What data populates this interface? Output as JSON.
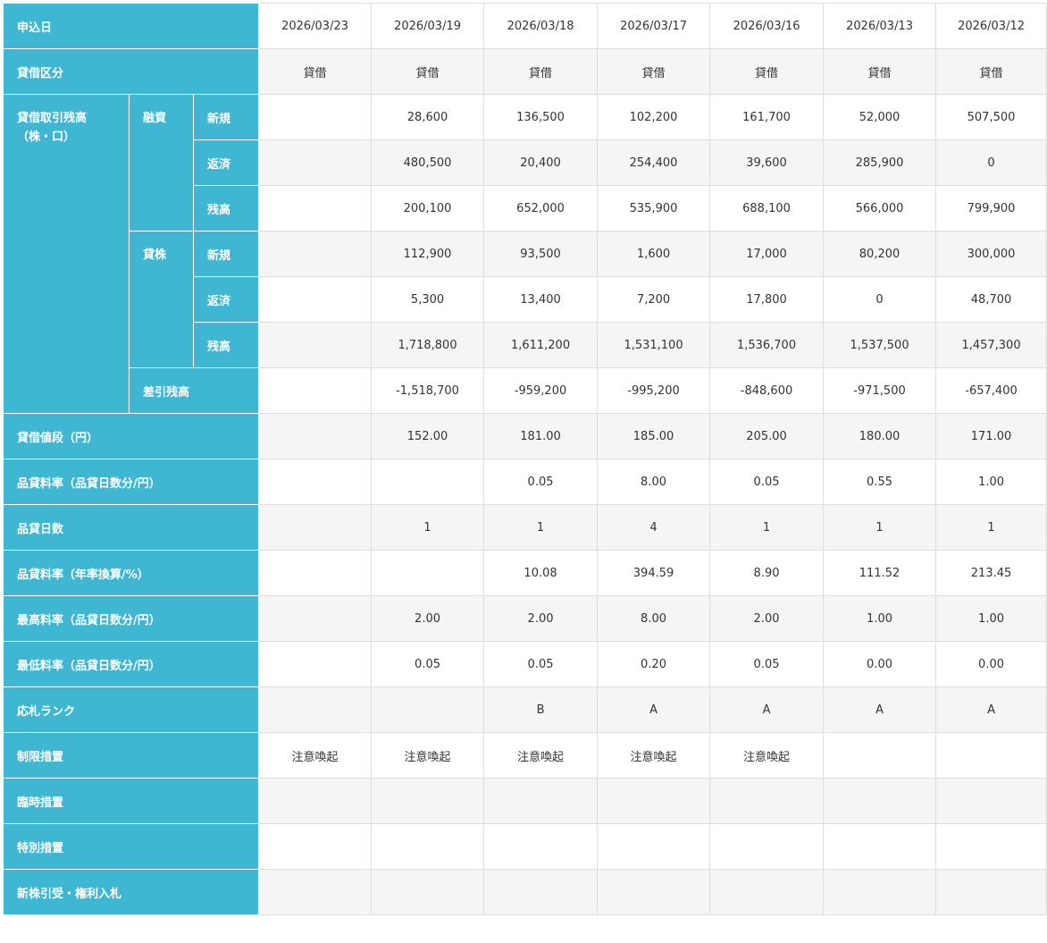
{
  "dates": [
    "2026/03/23",
    "2026/03/19",
    "2026/03/18",
    "2026/03/17",
    "2026/03/16",
    "2026/03/13",
    "2026/03/12"
  ],
  "labels": {
    "date": "申込日",
    "type": "貸借区分",
    "balance_line1": "貸借取引残高",
    "balance_line2": "（株・口）",
    "loan_funds": "融資",
    "loan_stock": "貸株",
    "new": "新規",
    "repay": "返済",
    "balance": "残高",
    "net": "差引残高",
    "price": "貸借値段（円）",
    "fee_rate": "品貸料率（品貸日数分/円）",
    "fee_days": "品貸日数",
    "fee_annual": "品貸料率（年率換算/%）",
    "max_rate": "最高料率（品貸日数分/円）",
    "min_rate": "最低料率（品貸日数分/円）",
    "bid_rank": "応札ランク",
    "restriction": "制限措置",
    "temporary": "臨時措置",
    "special": "特別措置",
    "new_shares": "新株引受・権利入札"
  },
  "rows": {
    "type": [
      "貸借",
      "貸借",
      "貸借",
      "貸借",
      "貸借",
      "貸借",
      "貸借"
    ],
    "funds_new": [
      "",
      "28,600",
      "136,500",
      "102,200",
      "161,700",
      "52,000",
      "507,500"
    ],
    "funds_repay": [
      "",
      "480,500",
      "20,400",
      "254,400",
      "39,600",
      "285,900",
      "0"
    ],
    "funds_balance": [
      "",
      "200,100",
      "652,000",
      "535,900",
      "688,100",
      "566,000",
      "799,900"
    ],
    "stock_new": [
      "",
      "112,900",
      "93,500",
      "1,600",
      "17,000",
      "80,200",
      "300,000"
    ],
    "stock_repay": [
      "",
      "5,300",
      "13,400",
      "7,200",
      "17,800",
      "0",
      "48,700"
    ],
    "stock_balance": [
      "",
      "1,718,800",
      "1,611,200",
      "1,531,100",
      "1,536,700",
      "1,537,500",
      "1,457,300"
    ],
    "net": [
      "",
      "-1,518,700",
      "-959,200",
      "-995,200",
      "-848,600",
      "-971,500",
      "-657,400"
    ],
    "price": [
      "",
      "152.00",
      "181.00",
      "185.00",
      "205.00",
      "180.00",
      "171.00"
    ],
    "fee_rate": [
      "",
      "",
      "0.05",
      "8.00",
      "0.05",
      "0.55",
      "1.00"
    ],
    "fee_days": [
      "",
      "1",
      "1",
      "4",
      "1",
      "1",
      "1"
    ],
    "fee_annual": [
      "",
      "",
      "10.08",
      "394.59",
      "8.90",
      "111.52",
      "213.45"
    ],
    "max_rate": [
      "",
      "2.00",
      "2.00",
      "8.00",
      "2.00",
      "1.00",
      "1.00"
    ],
    "min_rate": [
      "",
      "0.05",
      "0.05",
      "0.20",
      "0.05",
      "0.00",
      "0.00"
    ],
    "bid_rank": [
      "",
      "",
      "B",
      "A",
      "A",
      "A",
      "A"
    ],
    "restriction": [
      "注意喚起",
      "注意喚起",
      "注意喚起",
      "注意喚起",
      "注意喚起",
      "",
      ""
    ],
    "temporary": [
      "",
      "",
      "",
      "",
      "",
      "",
      ""
    ],
    "special": [
      "",
      "",
      "",
      "",
      "",
      "",
      ""
    ],
    "new_shares": [
      "",
      "",
      "",
      "",
      "",
      "",
      ""
    ]
  },
  "colors": {
    "header_bg": "#3fb7d2",
    "header_text": "#ffffff",
    "row_alt_bg": "#f5f5f5",
    "border": "#dedede",
    "text": "#333333"
  }
}
